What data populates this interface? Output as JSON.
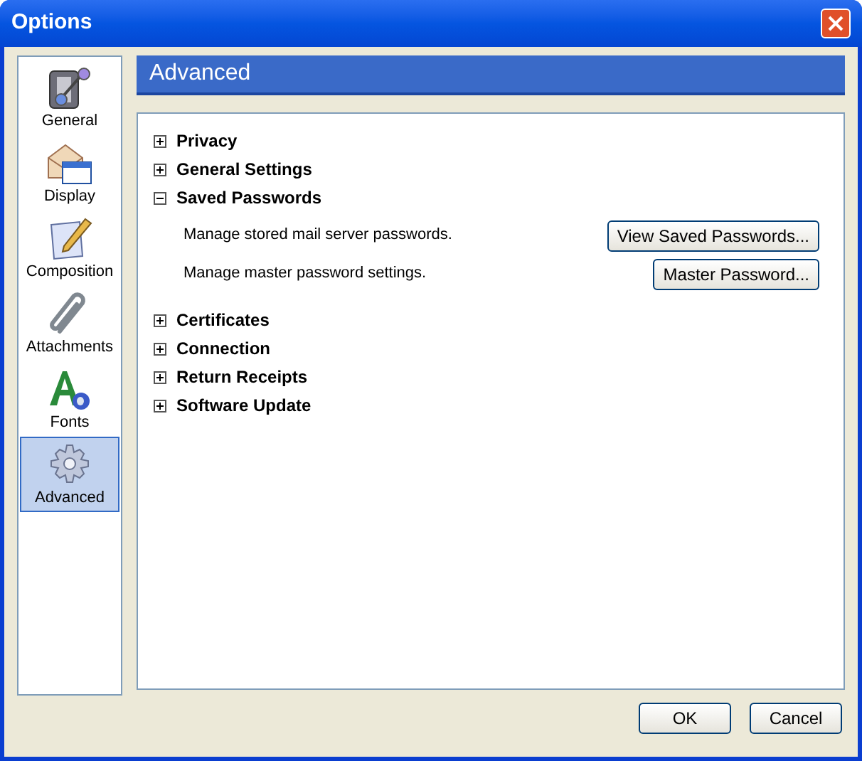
{
  "window": {
    "title": "Options"
  },
  "sidebar": {
    "items": [
      {
        "label": "General",
        "selected": false,
        "kind": "general"
      },
      {
        "label": "Display",
        "selected": false,
        "kind": "display"
      },
      {
        "label": "Composition",
        "selected": false,
        "kind": "composition"
      },
      {
        "label": "Attachments",
        "selected": false,
        "kind": "attachments"
      },
      {
        "label": "Fonts",
        "selected": false,
        "kind": "fonts"
      },
      {
        "label": "Advanced",
        "selected": true,
        "kind": "advanced"
      }
    ]
  },
  "panel": {
    "title": "Advanced",
    "sections": [
      {
        "label": "Privacy",
        "expanded": false
      },
      {
        "label": "General Settings",
        "expanded": false
      },
      {
        "label": "Saved Passwords",
        "expanded": true,
        "children": [
          {
            "text": "Manage stored mail server passwords.",
            "button": "View Saved Passwords..."
          },
          {
            "text": "Manage master password settings.",
            "button": "Master Password..."
          }
        ]
      },
      {
        "label": "Certificates",
        "expanded": false
      },
      {
        "label": "Connection",
        "expanded": false
      },
      {
        "label": "Return Receipts",
        "expanded": false
      },
      {
        "label": "Software Update",
        "expanded": false
      }
    ]
  },
  "buttons": [
    "OK",
    "Cancel"
  ]
}
